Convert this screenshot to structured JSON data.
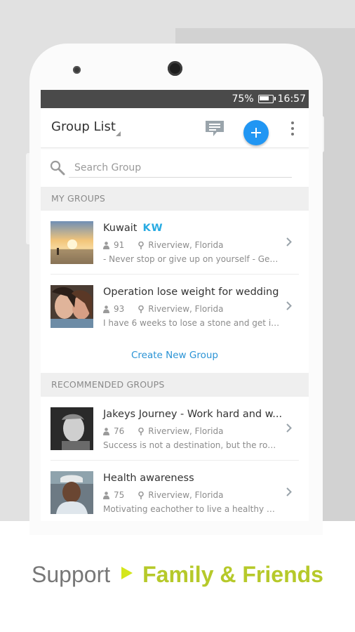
{
  "status_bar": {
    "battery": "75%",
    "time": "16:57"
  },
  "app_bar": {
    "title": "Group List"
  },
  "search": {
    "placeholder": "Search Group"
  },
  "sections": {
    "my_groups": "MY GROUPS",
    "recommended": "RECOMMENDED GROUPS"
  },
  "my_groups": [
    {
      "name": "Kuwait",
      "tag": "KW",
      "members": "91",
      "location": "Riverview, Florida",
      "description": "- Never stop or give up on yourself  - Get..."
    },
    {
      "name": "Operation lose weight  for wedding",
      "members": "93",
      "location": "Riverview, Florida",
      "description": "I have 6 weeks to lose a stone and get into..."
    }
  ],
  "create_group_label": "Create New Group",
  "recommended_groups": [
    {
      "name": "Jakeys Journey - Work hard and w...",
      "members": "76",
      "location": "Riverview, Florida",
      "description": "Success is not a destination, but the road..."
    },
    {
      "name": "Health awareness",
      "members": "75",
      "location": "Riverview, Florida",
      "description": "Motivating eachother to live a healthy and..."
    }
  ],
  "tagline": {
    "part1": "Support",
    "part2": "Family & Friends"
  },
  "colors": {
    "accent": "#2196f3",
    "link": "#2a93d5",
    "tag": "#29abe2",
    "tagline_highlight": "#b6c92a"
  },
  "icons": [
    "chat-icon",
    "add-icon",
    "more-vert-icon",
    "search-icon",
    "person-icon",
    "location-pin-icon",
    "chevron-right-icon",
    "battery-icon",
    "play-arrow-icon"
  ]
}
